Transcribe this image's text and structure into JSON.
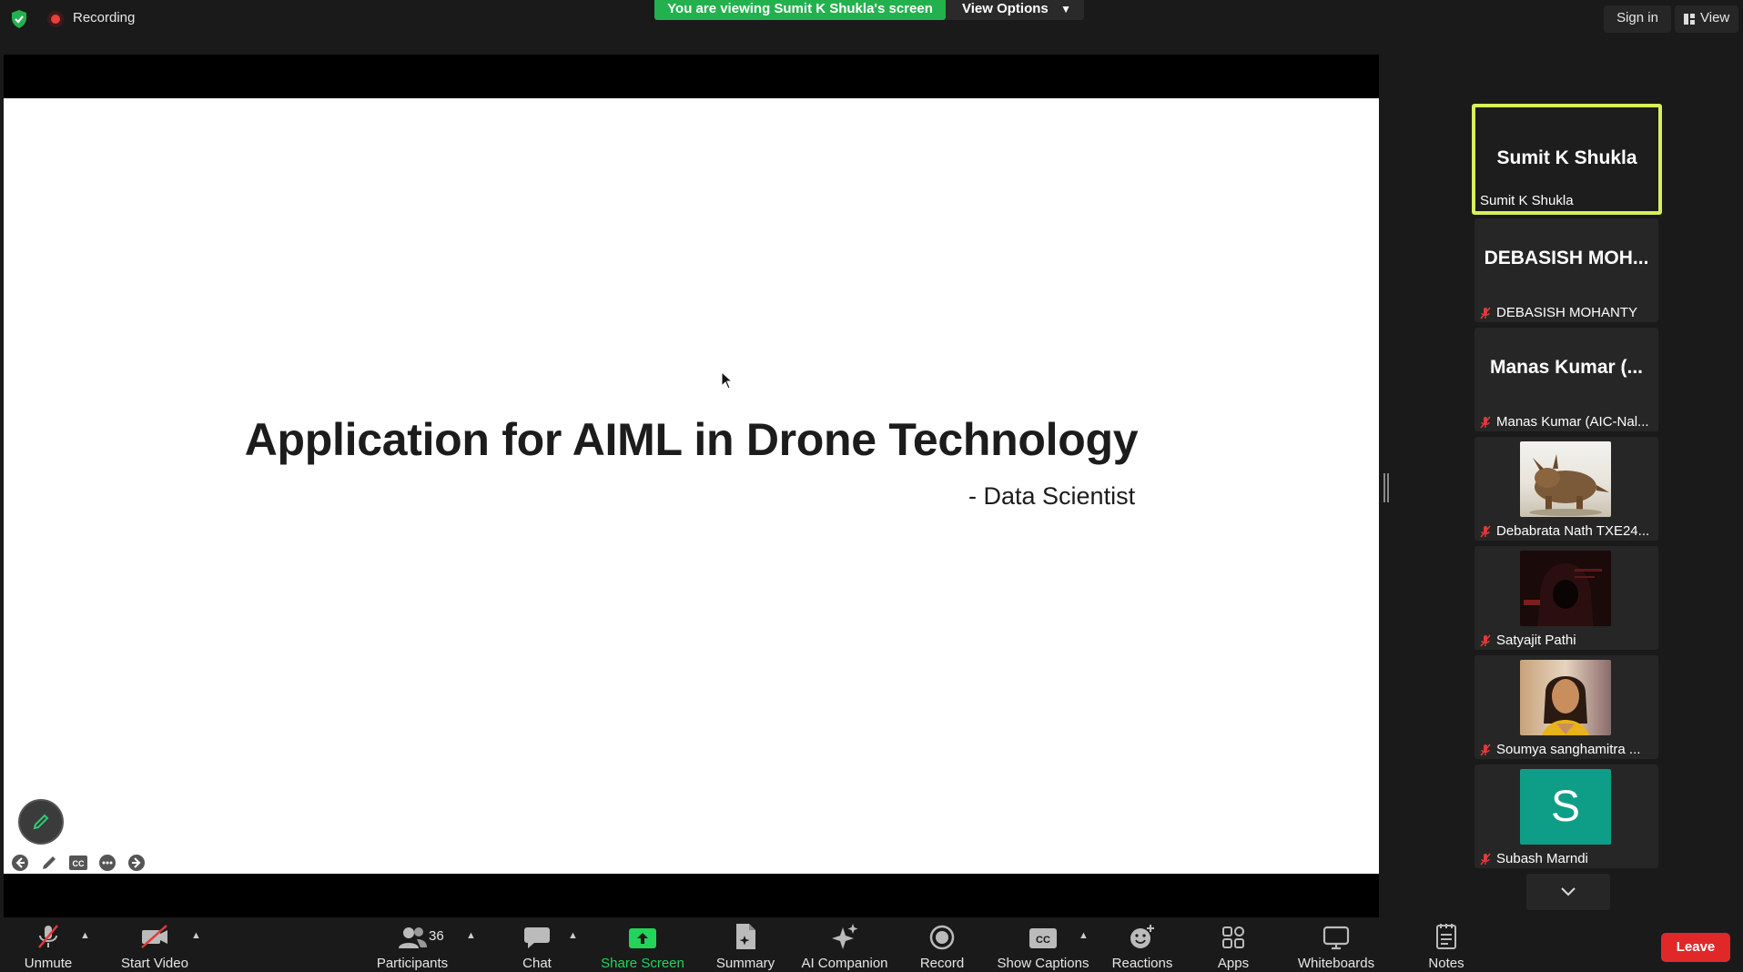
{
  "topbar": {
    "recording_label": "Recording",
    "viewing_banner": "You are viewing Sumit K Shukla's screen",
    "view_options_label": "View Options",
    "signin_label": "Sign in",
    "view_label": "View"
  },
  "slide": {
    "title": "Application for AIML in Drone Technology",
    "subtitle": "- Data Scientist"
  },
  "gallery": {
    "tiles": [
      {
        "big_name": "Sumit K Shukla",
        "name": "Sumit K Shukla",
        "muted": false,
        "active": true
      },
      {
        "big_name": "DEBASISH  MOH...",
        "name": "DEBASISH MOHANTY",
        "muted": true
      },
      {
        "big_name": "Manas Kumar  (...",
        "name": "Manas Kumar (AIC-Nal...",
        "muted": true
      },
      {
        "name": "Debabrata Nath TXE24...",
        "muted": true,
        "avatar": "dinosaur-photo"
      },
      {
        "name": "Satyajit Pathi",
        "muted": true,
        "avatar": "hooded-figure-photo"
      },
      {
        "name": "Soumya sanghamitra ...",
        "muted": true,
        "avatar": "portrait-photo"
      },
      {
        "name": "Subash Marndi",
        "muted": true,
        "avatar_letter": "S"
      }
    ]
  },
  "toolbar": {
    "unmute": "Unmute",
    "start_video": "Start Video",
    "participants": "Participants",
    "participants_count": "36",
    "chat": "Chat",
    "share_screen": "Share Screen",
    "summary": "Summary",
    "ai_companion": "AI Companion",
    "record": "Record",
    "show_captions": "Show Captions",
    "reactions": "Reactions",
    "apps": "Apps",
    "whiteboards": "Whiteboards",
    "notes": "Notes",
    "leave": "Leave"
  },
  "colors": {
    "banner_green": "#23b14d",
    "active_speaker_border": "#d8f05a",
    "leave_red": "#e02828",
    "recording_red": "#e8403b",
    "share_green": "#23d35a"
  }
}
